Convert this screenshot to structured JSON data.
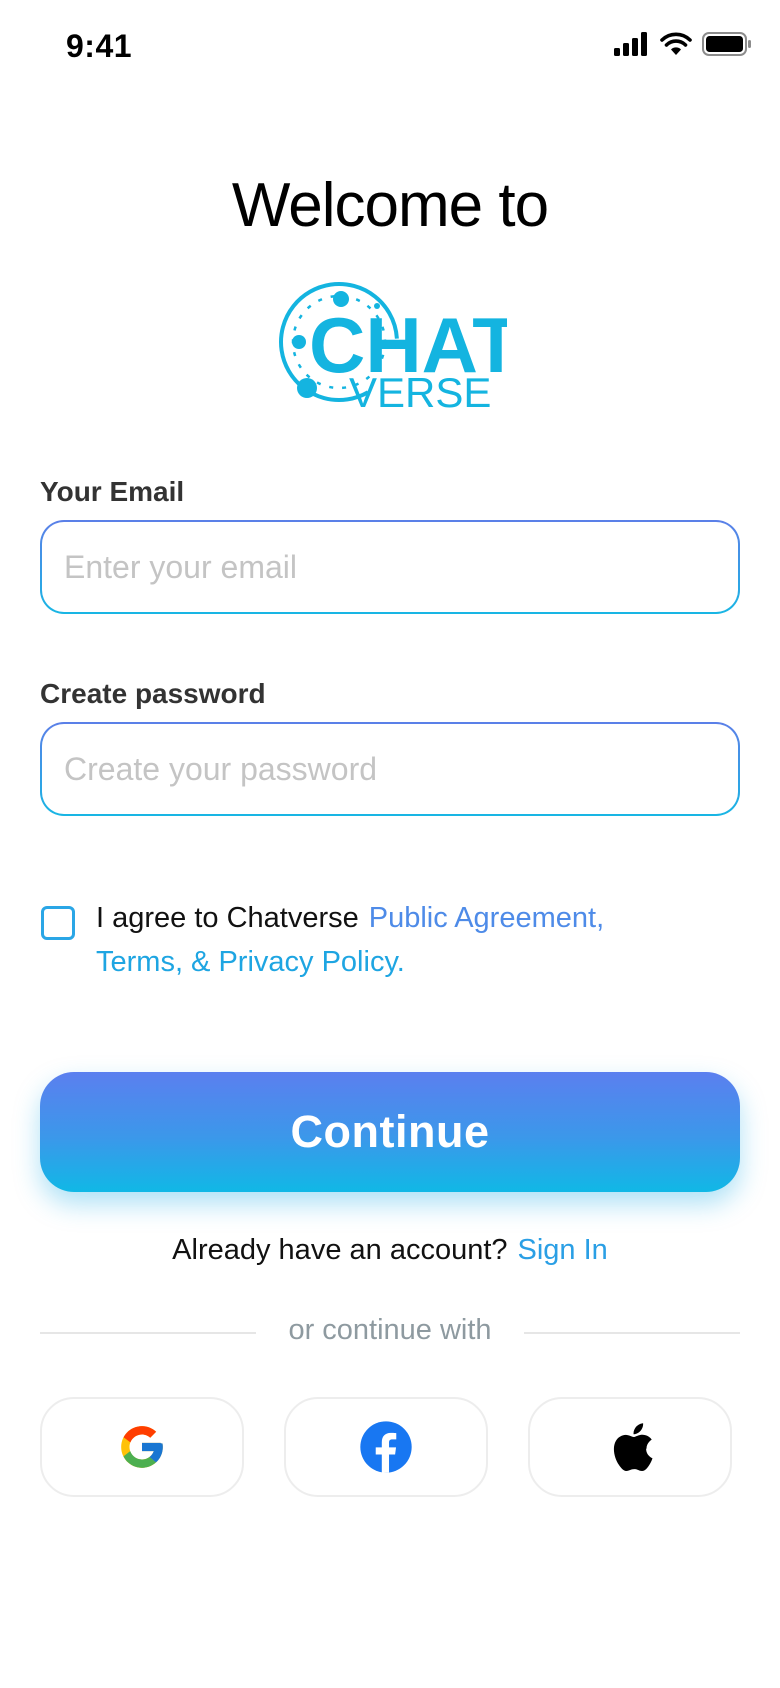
{
  "status_bar": {
    "time": "9:41"
  },
  "header": {
    "welcome": "Welcome to"
  },
  "logo": {
    "line1": "CHAT",
    "line2": "VERSE",
    "color": "#14b4e0"
  },
  "email": {
    "label": "Your Email",
    "placeholder": "Enter your email",
    "value": ""
  },
  "password": {
    "label": "Create password",
    "placeholder": "Create your password",
    "value": ""
  },
  "agreement": {
    "checked": false,
    "text": "I agree to Chatverse",
    "link_public": "Public Agreement,",
    "link_terms": "Terms, & Privacy Policy."
  },
  "continue_button": {
    "label": "Continue"
  },
  "signin": {
    "prompt": "Already have an account?",
    "link": "Sign In"
  },
  "divider": {
    "text": "or continue with"
  },
  "social": [
    {
      "icon": "google-icon"
    },
    {
      "icon": "facebook-icon"
    },
    {
      "icon": "apple-icon"
    }
  ],
  "colors": {
    "accent_blue": "#5b7fef",
    "accent_cyan": "#10b8e6",
    "link": "#2a9fe5"
  }
}
